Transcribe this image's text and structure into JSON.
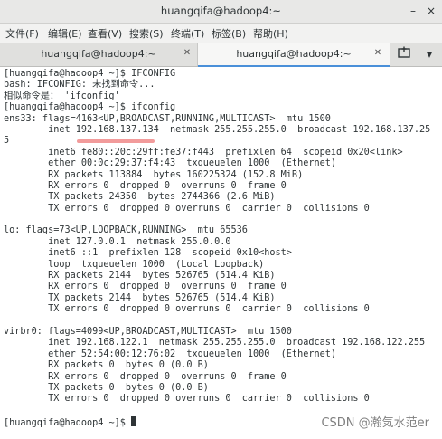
{
  "window": {
    "title": "huangqifa@hadoop4:~",
    "minimize_glyph": "–",
    "close_glyph": "×"
  },
  "menu": [
    "文件(F)",
    "编辑(E)",
    "查看(V)",
    "搜索(S)",
    "终端(T)",
    "标签(B)",
    "帮助(H)"
  ],
  "tabs": [
    {
      "label": "huangqifa@hadoop4:~",
      "active": false
    },
    {
      "label": "huangqifa@hadoop4:~",
      "active": true
    }
  ],
  "toolbar": {
    "new_tab_icon": "new-tab-icon",
    "menu_icon": "chevron-down-icon"
  },
  "terminal": {
    "lines": [
      "[huangqifa@hadoop4 ~]$ IFCONFIG",
      "bash: IFCONFIG: 未找到命令...",
      "相似命令是： 'ifconfig'",
      "[huangqifa@hadoop4 ~]$ ifconfig",
      "ens33: flags=4163<UP,BROADCAST,RUNNING,MULTICAST>  mtu 1500",
      "        inet 192.168.137.134  netmask 255.255.255.0  broadcast 192.168.137.25",
      "5",
      "        inet6 fe80::20c:29ff:fe37:f443  prefixlen 64  scopeid 0x20<link>",
      "        ether 00:0c:29:37:f4:43  txqueuelen 1000  (Ethernet)",
      "        RX packets 113884  bytes 160225324 (152.8 MiB)",
      "        RX errors 0  dropped 0  overruns 0  frame 0",
      "        TX packets 24350  bytes 2744366 (2.6 MiB)",
      "        TX errors 0  dropped 0 overruns 0  carrier 0  collisions 0",
      "",
      "lo: flags=73<UP,LOOPBACK,RUNNING>  mtu 65536",
      "        inet 127.0.0.1  netmask 255.0.0.0",
      "        inet6 ::1  prefixlen 128  scopeid 0x10<host>",
      "        loop  txqueuelen 1000  (Local Loopback)",
      "        RX packets 2144  bytes 526765 (514.4 KiB)",
      "        RX errors 0  dropped 0  overruns 0  frame 0",
      "        TX packets 2144  bytes 526765 (514.4 KiB)",
      "        TX errors 0  dropped 0 overruns 0  carrier 0  collisions 0",
      "",
      "virbr0: flags=4099<UP,BROADCAST,MULTICAST>  mtu 1500",
      "        inet 192.168.122.1  netmask 255.255.255.0  broadcast 192.168.122.255",
      "        ether 52:54:00:12:76:02  txqueuelen 1000  (Ethernet)",
      "        RX packets 0  bytes 0 (0.0 B)",
      "        RX errors 0  dropped 0  overruns 0  frame 0",
      "        TX packets 0  bytes 0 (0.0 B)",
      "        TX errors 0  dropped 0 overruns 0  carrier 0  collisions 0",
      "",
      "[huangqifa@hadoop4 ~]$ "
    ]
  },
  "watermark": "CSDN @瀚気水范er",
  "colors": {
    "titlebar": "#e8e8e7",
    "menubar": "#f2f2f1",
    "tabbar": "#e0e0de",
    "terminal_text": "#2e3436",
    "highlight": "#f08a8a"
  }
}
